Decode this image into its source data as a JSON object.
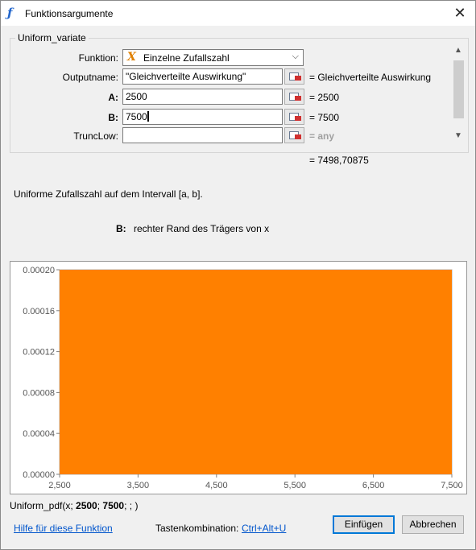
{
  "window": {
    "title": "Funktionsargumente",
    "close_glyph": "✕",
    "title_icon": "ƒ"
  },
  "group": {
    "title": "Uniform_variate"
  },
  "function_row": {
    "label": "Funktion:",
    "icon": "fx-icon",
    "glyph": "X",
    "value": "Einzelne Zufallszahl",
    "chevron": "⌵"
  },
  "args": [
    {
      "label": "Outputname:",
      "value": "\"Gleichverteilte Auswirkung\"",
      "result": "= Gleichverteilte Auswirkung"
    },
    {
      "label": "A:",
      "value": "2500",
      "result": "= 2500"
    },
    {
      "label": "B:",
      "value": "7500",
      "result": "= 7500"
    },
    {
      "label": "TruncLow:",
      "value": "",
      "result": "= any"
    }
  ],
  "scroll": {
    "up": "▲",
    "down": "▼"
  },
  "total_result": "=  7498,70875",
  "description": "Uniforme Zufallszahl auf dem Intervall [a, b].",
  "arg_help": {
    "name": "B:",
    "text": "rechter Rand des Trägers von x"
  },
  "chart_data": {
    "type": "area",
    "x": [
      2500,
      7500
    ],
    "series": [
      {
        "values": [
          0.0002,
          0.0002
        ]
      }
    ],
    "xticks": [
      "2,500",
      "3,500",
      "4,500",
      "5,500",
      "6,500",
      "7,500"
    ],
    "yticks": [
      "0.00000",
      "0.00004",
      "0.00008",
      "0.00012",
      "0.00016",
      "0.00020"
    ],
    "xlim": [
      2500,
      7500
    ],
    "ylim": [
      0,
      0.0002
    ],
    "fill_color": "#ff8000"
  },
  "formula": {
    "prefix": "Uniform_pdf(x; ",
    "a": "2500",
    "sep": "; ",
    "b": "7500",
    "suffix": "; ; )"
  },
  "footer": {
    "help_link": "Hilfe für diese Funktion",
    "shortcut_label": "Tastenkombination:",
    "shortcut_value": "Ctrl+Alt+U",
    "insert_label": "Einfügen",
    "cancel_label": "Abbrechen"
  }
}
